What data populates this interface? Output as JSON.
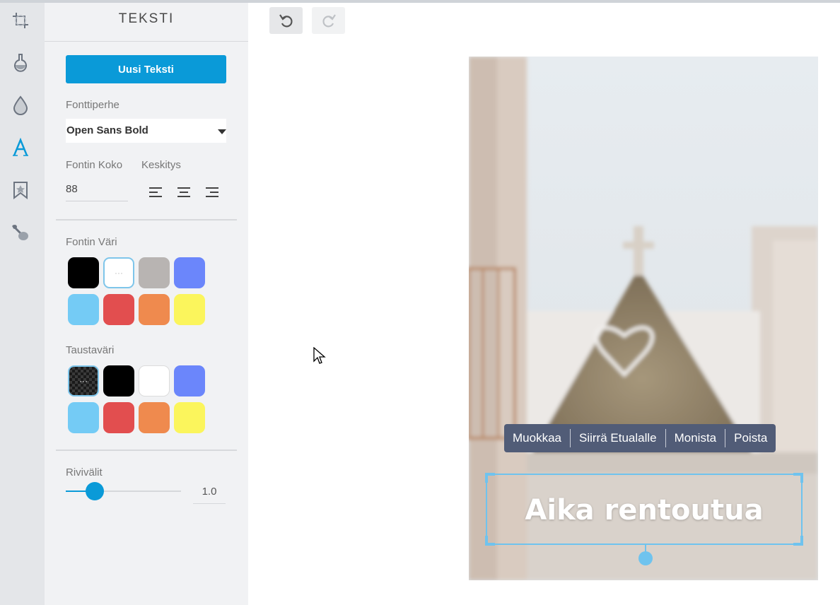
{
  "panel": {
    "title": "TEKSTI",
    "new_text_button": "Uusi Teksti",
    "font_family_label": "Fonttiperhe",
    "font_family_value": "Open Sans Bold",
    "font_size_label": "Fontin Koko",
    "font_size_value": "88",
    "alignment_label": "Keskitys",
    "font_color_label": "Fontin Väri",
    "font_colors": [
      "#000000",
      "#ffffff",
      "#b8b4b2",
      "#6b86fb",
      "#74cbf5",
      "#e24e4f",
      "#ef8a4e",
      "#fbf55c"
    ],
    "background_color_label": "Taustaväri",
    "background_colors": [
      "transparent",
      "#000000",
      "#ffffff",
      "#6b86fb",
      "#74cbf5",
      "#e24e4f",
      "#ef8a4e",
      "#fbf55c"
    ],
    "line_spacing_label": "Rivivälit",
    "line_spacing_value": "1.0",
    "line_spacing_fraction": 0.25
  },
  "rail_icons": [
    "crop-icon",
    "flask-icon",
    "drop-icon",
    "text-icon",
    "bookmark-icon",
    "brush-icon"
  ],
  "toolbar": {
    "undo": "undo-icon",
    "redo": "redo-icon"
  },
  "context_menu": [
    "Muokkaa",
    "Siirrä Etualalle",
    "Monista",
    "Poista"
  ],
  "canvas": {
    "text": "Aika rentoutua"
  },
  "colors": {
    "accent": "#0a9ad8",
    "selection": "#6fc3ee",
    "menu_bg": "#515c77"
  }
}
